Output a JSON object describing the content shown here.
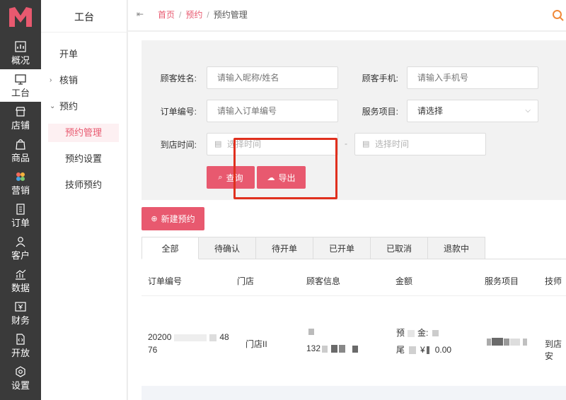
{
  "rail": {
    "items": [
      {
        "label": "概况",
        "icon": "chart-icon"
      },
      {
        "label": "工台",
        "icon": "monitor-icon"
      },
      {
        "label": "店铺",
        "icon": "store-icon"
      },
      {
        "label": "商品",
        "icon": "bag-icon"
      },
      {
        "label": "营销",
        "icon": "flower-icon"
      },
      {
        "label": "订单",
        "icon": "order-icon"
      },
      {
        "label": "客户",
        "icon": "user-icon"
      },
      {
        "label": "数据",
        "icon": "data-icon"
      },
      {
        "label": "财务",
        "icon": "finance-icon"
      },
      {
        "label": "开放",
        "icon": "code-icon"
      },
      {
        "label": "设置",
        "icon": "gear-icon"
      }
    ],
    "active_index": 1
  },
  "submenu": {
    "title": "工台",
    "items": [
      {
        "label": "开单"
      },
      {
        "label": "核销"
      },
      {
        "label": "预约"
      }
    ],
    "sub_items": [
      {
        "label": "预约管理"
      },
      {
        "label": "预约设置"
      },
      {
        "label": "技师预约"
      }
    ]
  },
  "breadcrumb": {
    "home": "首页",
    "section": "预约",
    "current": "预约管理",
    "separator": "/"
  },
  "filter": {
    "customer_name_label": "顾客姓名:",
    "customer_name_placeholder": "请输入昵称/姓名",
    "customer_phone_label": "顾客手机:",
    "customer_phone_placeholder": "请输入手机号",
    "order_no_label": "订单编号:",
    "order_no_placeholder": "请输入订单编号",
    "service_label": "服务项目:",
    "service_value": "请选择",
    "visit_time_label": "到店时间:",
    "time_start_placeholder": "选择时间",
    "time_end_placeholder": "选择时间",
    "range_dash": "-",
    "query_label": "查询",
    "export_label": "导出"
  },
  "new_button": {
    "label": "新建预约"
  },
  "tabs": [
    {
      "label": "全部"
    },
    {
      "label": "待确认"
    },
    {
      "label": "待开单"
    },
    {
      "label": "已开单"
    },
    {
      "label": "已取消"
    },
    {
      "label": "退款中"
    }
  ],
  "table": {
    "headers": [
      "订单编号",
      "门店",
      "顾客信息",
      "金额",
      "服务项目",
      "技师"
    ],
    "rows": [
      {
        "order_no_prefix": "20200",
        "order_no_suffix": "48",
        "order_no_line2": "76",
        "store": "门店II",
        "phone_prefix": "132",
        "amount_pre_label": "预",
        "amount_pre_mid": "金:",
        "amount_tail_label": "尾",
        "amount_tail_currency": "¥",
        "amount_tail_value": "0.00",
        "tech": "到店安"
      }
    ]
  },
  "colors": {
    "accent": "#e8596f",
    "rail_bg": "#3a3a3a",
    "highlight": "#e0301e"
  }
}
